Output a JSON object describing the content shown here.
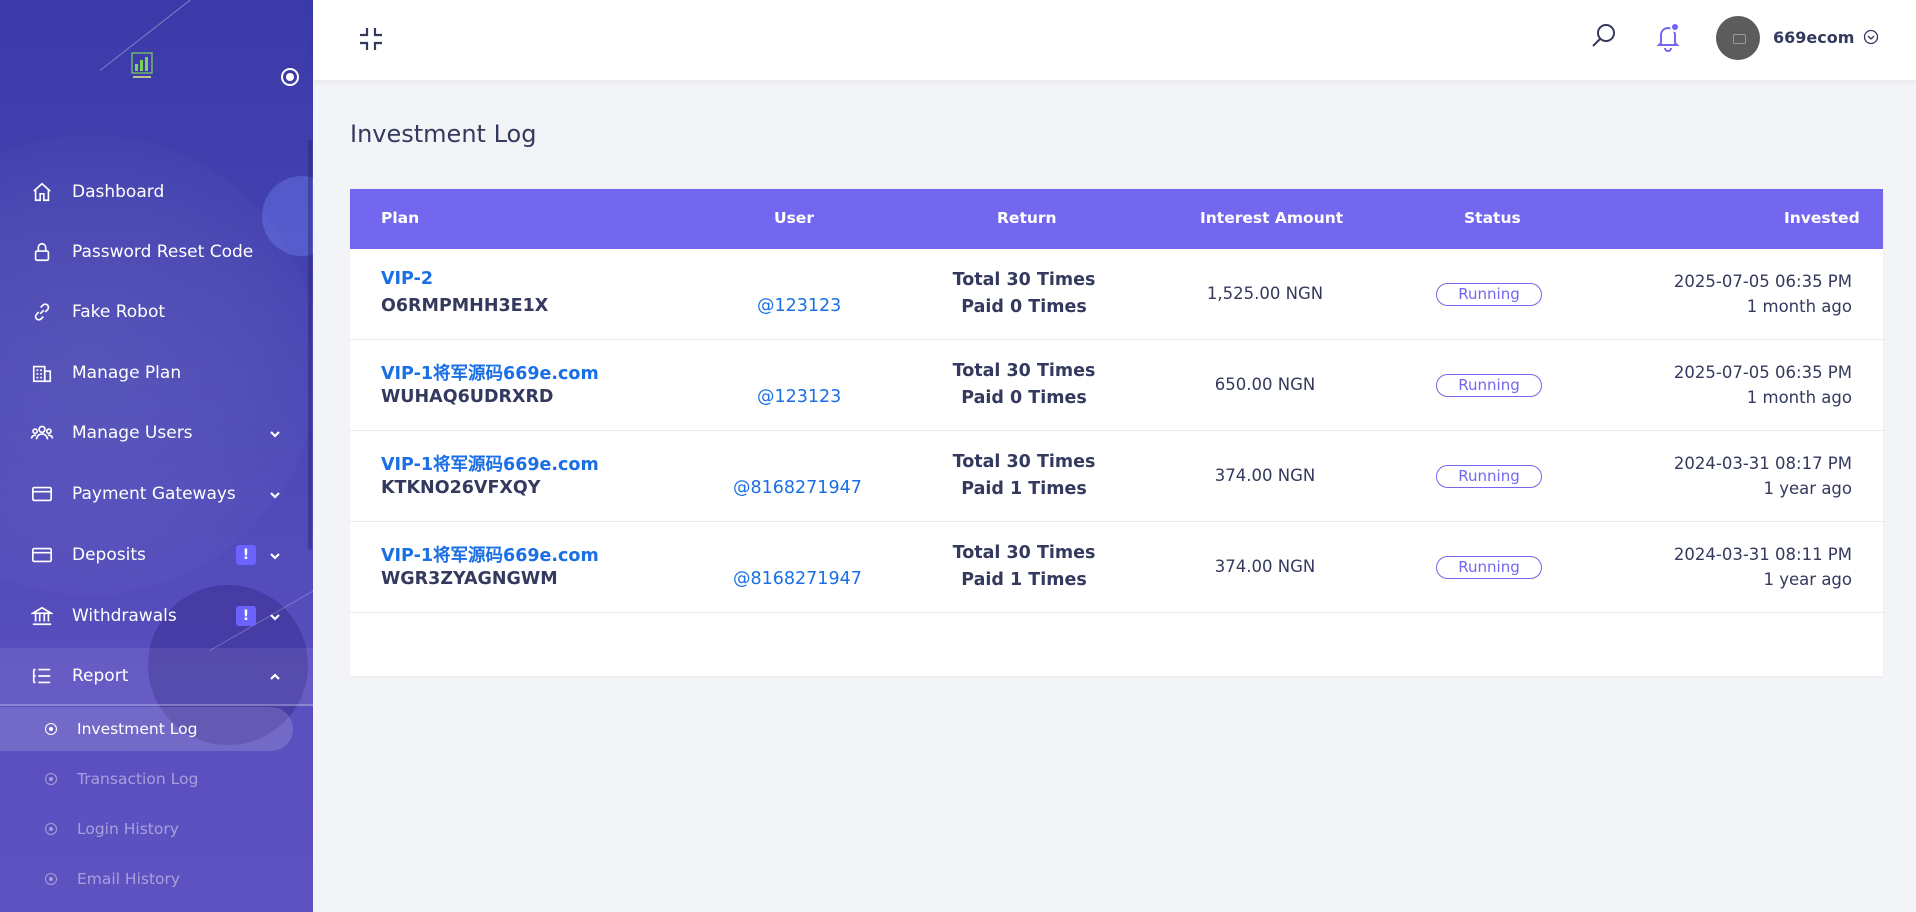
{
  "sidebar": {
    "items": [
      {
        "label": "Dashboard",
        "icon": "home-icon"
      },
      {
        "label": "Password Reset Code",
        "icon": "lock-icon"
      },
      {
        "label": "Fake Robot",
        "icon": "link-icon"
      },
      {
        "label": "Manage Plan",
        "icon": "building-icon"
      },
      {
        "label": "Manage Users",
        "icon": "users-icon"
      },
      {
        "label": "Payment Gateways",
        "icon": "credit-card-icon"
      },
      {
        "label": "Deposits",
        "icon": "credit-card-icon",
        "badge": "!"
      },
      {
        "label": "Withdrawals",
        "icon": "bank-icon",
        "badge": "!"
      },
      {
        "label": "Report",
        "icon": "list-icon"
      }
    ],
    "report_sub": [
      {
        "label": "Investment Log"
      },
      {
        "label": "Transaction Log"
      },
      {
        "label": "Login History"
      },
      {
        "label": "Email History"
      }
    ]
  },
  "header": {
    "username": "669ecom"
  },
  "page": {
    "title": "Investment Log"
  },
  "table": {
    "columns": [
      "Plan",
      "User",
      "Return",
      "Interest Amount",
      "Status",
      "Invested"
    ],
    "rows": [
      {
        "plan": "VIP-2",
        "code": "O6RMPMHH3E1X",
        "user": "@123123",
        "return_total": "Total 30 Times",
        "return_paid": "Paid 0 Times",
        "amount": "1,525.00 NGN",
        "status": "Running",
        "date": "2025-07-05 06:35 PM",
        "ago": "1 month ago"
      },
      {
        "plan": "VIP-1将军源码669e.com",
        "code": "WUHAQ6UDRXRD",
        "user": "@123123",
        "return_total": "Total 30 Times",
        "return_paid": "Paid 0 Times",
        "amount": "650.00 NGN",
        "status": "Running",
        "date": "2025-07-05 06:35 PM",
        "ago": "1 month ago"
      },
      {
        "plan": "VIP-1将军源码669e.com",
        "code": "KTKNO26VFXQY",
        "user": "@8168271947",
        "return_total": "Total 30 Times",
        "return_paid": "Paid 1 Times",
        "amount": "374.00 NGN",
        "status": "Running",
        "date": "2024-03-31 08:17 PM",
        "ago": "1 year ago"
      },
      {
        "plan": "VIP-1将军源码669e.com",
        "code": "WGR3ZYAGNGWM",
        "user": "@8168271947",
        "return_total": "Total 30 Times",
        "return_paid": "Paid 1 Times",
        "amount": "374.00 NGN",
        "status": "Running",
        "date": "2024-03-31 08:11 PM",
        "ago": "1 year ago"
      }
    ]
  },
  "colors": {
    "accent": "#7367f0",
    "link": "#1a6fe6",
    "sidebar_top": "#3b3aa8",
    "sidebar_bottom": "#5e52c1"
  }
}
